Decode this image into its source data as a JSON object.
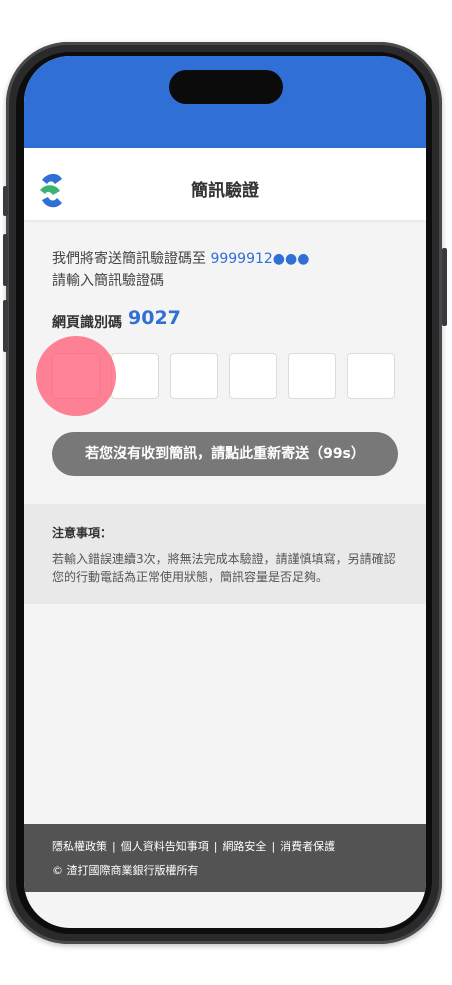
{
  "header": {
    "title": "簡訊驗證"
  },
  "intro": {
    "line1": "我們將寄送簡訊驗證碼至",
    "phone": "9999912●●●",
    "line2": "請輸入簡訊驗證碼"
  },
  "identification": {
    "label": "網頁識別碼",
    "code": "9027"
  },
  "otp": {
    "boxes": [
      "",
      "",
      "",
      "",
      "",
      ""
    ]
  },
  "resend": {
    "label": "若您沒有收到簡訊，請點此重新寄送（99s）"
  },
  "notice": {
    "title": "注意事項：",
    "body": "若輸入錯誤連續3次，將無法完成本驗證，請謹慎填寫，另請確認您的行動電話為正常使用狀態，簡訊容量是否足夠。"
  },
  "footer": {
    "links": [
      "隱私權政策",
      "個人資料告知事項",
      "網路安全",
      "消費者保護"
    ],
    "separator": "|",
    "copyright": "© 渣打國際商業銀行版權所有"
  },
  "colors": {
    "brand_blue": "#2f6fd6",
    "brand_green": "#3cb371",
    "resend_button": "#787878",
    "footer_bg": "#535353",
    "touch_indicator": "#ff5f78"
  },
  "icons": {
    "logo": "standard-chartered-logo-icon"
  }
}
